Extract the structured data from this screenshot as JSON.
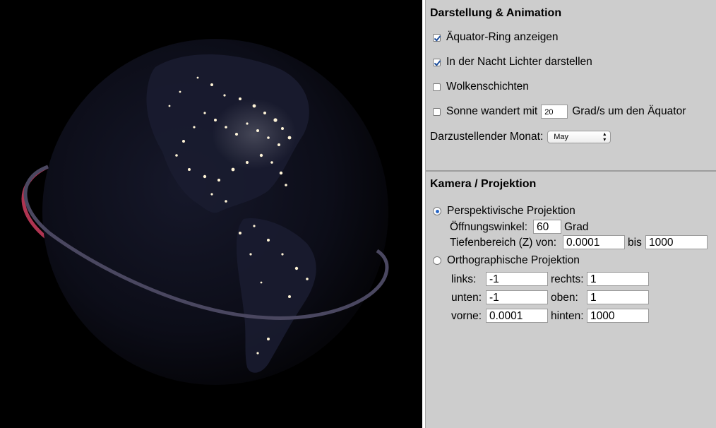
{
  "display_section": {
    "title": "Darstellung & Animation",
    "equator_ring": {
      "label": "Äquator-Ring anzeigen",
      "checked": true
    },
    "night_lights": {
      "label": "In der Nacht Lichter darstellen",
      "checked": true
    },
    "clouds": {
      "label": "Wolkenschichten",
      "checked": false
    },
    "sun": {
      "label_before": "Sonne wandert mit",
      "value": "20",
      "label_after": "Grad/s um den Äquator",
      "checked": false
    },
    "month": {
      "label": "Darzustellender Monat:",
      "value": "May"
    }
  },
  "camera_section": {
    "title": "Kamera / Projektion",
    "perspective": {
      "label": "Perspektivische Projektion",
      "selected": true,
      "fov_label": "Öffnungswinkel:",
      "fov_value": "60",
      "fov_unit": "Grad",
      "depth_label": "Tiefenbereich (Z) von:",
      "depth_from": "0.0001",
      "depth_to_label": "bis",
      "depth_to": "1000"
    },
    "orthographic": {
      "label": "Orthographische Projektion",
      "selected": false,
      "left_label": "links:",
      "left_value": "-1",
      "right_label": "rechts:",
      "right_value": "1",
      "bottom_label": "unten:",
      "bottom_value": "-1",
      "top_label": "oben:",
      "top_value": "1",
      "near_label": "vorne:",
      "near_value": "0.0001",
      "far_label": "hinten:",
      "far_value": "1000"
    }
  },
  "colors": {
    "panel_bg": "#cdcdcd",
    "ring_front": "#4a4760",
    "ring_back": "#c23a5a"
  }
}
